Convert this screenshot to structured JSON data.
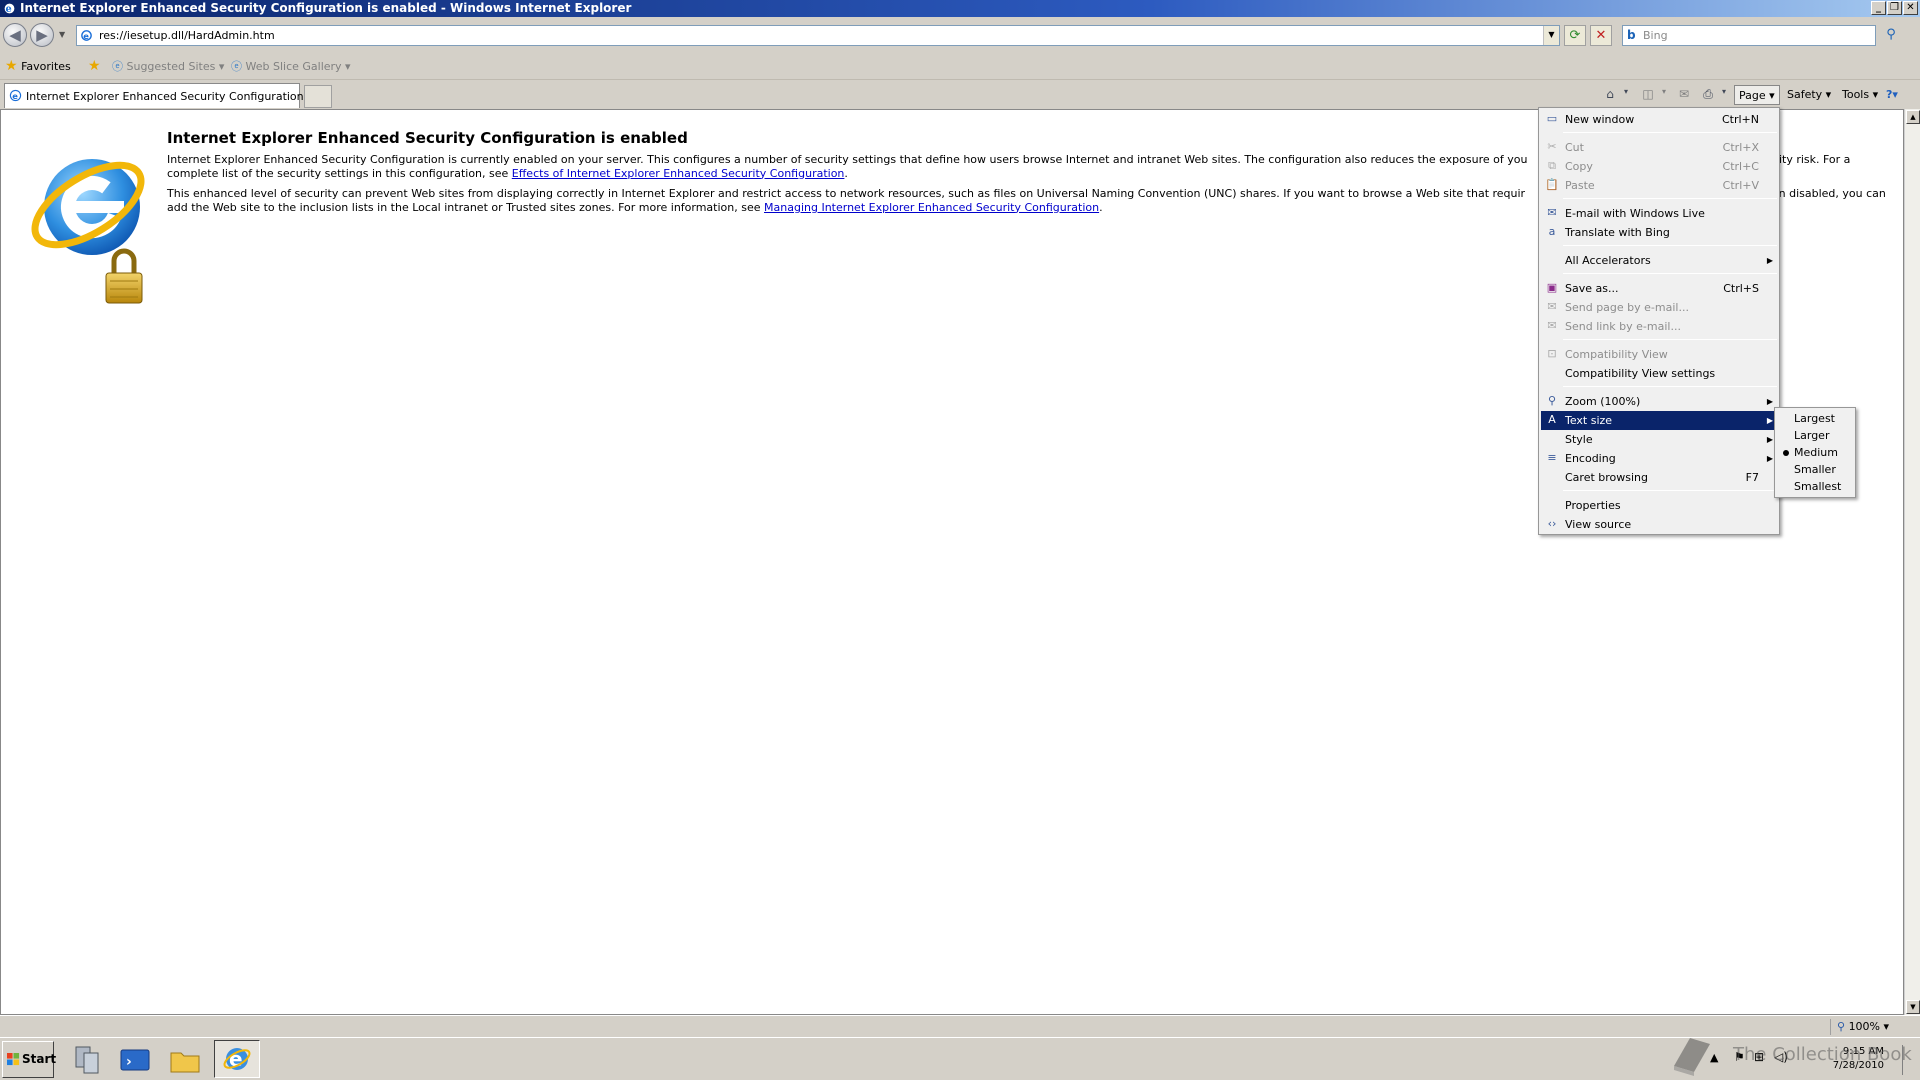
{
  "window": {
    "title": "Internet Explorer Enhanced Security Configuration is enabled - Windows Internet Explorer",
    "minimize": "_",
    "restore": "❐",
    "close": "✕"
  },
  "address_bar": {
    "url": "res://iesetup.dll/HardAdmin.htm",
    "search_placeholder": "Bing"
  },
  "favorites_bar": {
    "favorites": "Favorites",
    "suggested_sites": "Suggested Sites",
    "web_slice_gallery": "Web Slice Gallery"
  },
  "tab": {
    "label": "Internet Explorer Enhanced Security Configuration is ..."
  },
  "command_bar": {
    "page": "Page",
    "safety": "Safety",
    "tools": "Tools"
  },
  "content": {
    "heading": "Internet Explorer Enhanced Security Configuration is enabled",
    "p1_text": "Internet Explorer Enhanced Security Configuration is currently enabled on your server. This configures a number of security settings that define how users browse Internet and intranet Web sites. The configuration also reduces the exposure of you",
    "p1_text_b": "urity risk. For a complete list of the security settings in this configuration, see ",
    "p1_link": "Effects of Internet Explorer Enhanced Security Configuration",
    "p1_end": ".",
    "p2_text": "This enhanced level of security can prevent Web sites from displaying correctly in Internet Explorer and restrict access to network resources, such as files on Universal Naming Convention (UNC) shares. If you want to browse a Web site that requir",
    "p2_text_b": "een disabled, you can add the Web site to the inclusion lists in the Local intranet or Trusted sites zones. For more information, see ",
    "p2_link": "Managing Internet Explorer Enhanced Security Configuration",
    "p2_end": "."
  },
  "page_menu": {
    "new_window": "New window",
    "new_window_sc": "Ctrl+N",
    "cut": "Cut",
    "cut_sc": "Ctrl+X",
    "copy": "Copy",
    "copy_sc": "Ctrl+C",
    "paste": "Paste",
    "paste_sc": "Ctrl+V",
    "email_live": "E-mail with Windows Live",
    "translate_bing": "Translate with Bing",
    "all_accelerators": "All Accelerators",
    "save_as": "Save as...",
    "save_as_sc": "Ctrl+S",
    "send_page": "Send page by e-mail...",
    "send_link": "Send link by e-mail...",
    "compat_view": "Compatibility View",
    "compat_view_settings": "Compatibility View settings",
    "zoom": "Zoom (100%)",
    "text_size": "Text size",
    "style": "Style",
    "encoding": "Encoding",
    "caret_browsing": "Caret browsing",
    "caret_browsing_sc": "F7",
    "properties": "Properties",
    "view_source": "View source"
  },
  "text_size_menu": {
    "largest": "Largest",
    "larger": "Larger",
    "medium": "Medium",
    "smaller": "Smaller",
    "smallest": "Smallest",
    "selected": "Medium"
  },
  "status_bar": {
    "zoom": "100%"
  },
  "taskbar": {
    "start": "Start",
    "time": "9:15 AM",
    "date": "7/28/2010"
  },
  "watermark": "The Collection Book"
}
